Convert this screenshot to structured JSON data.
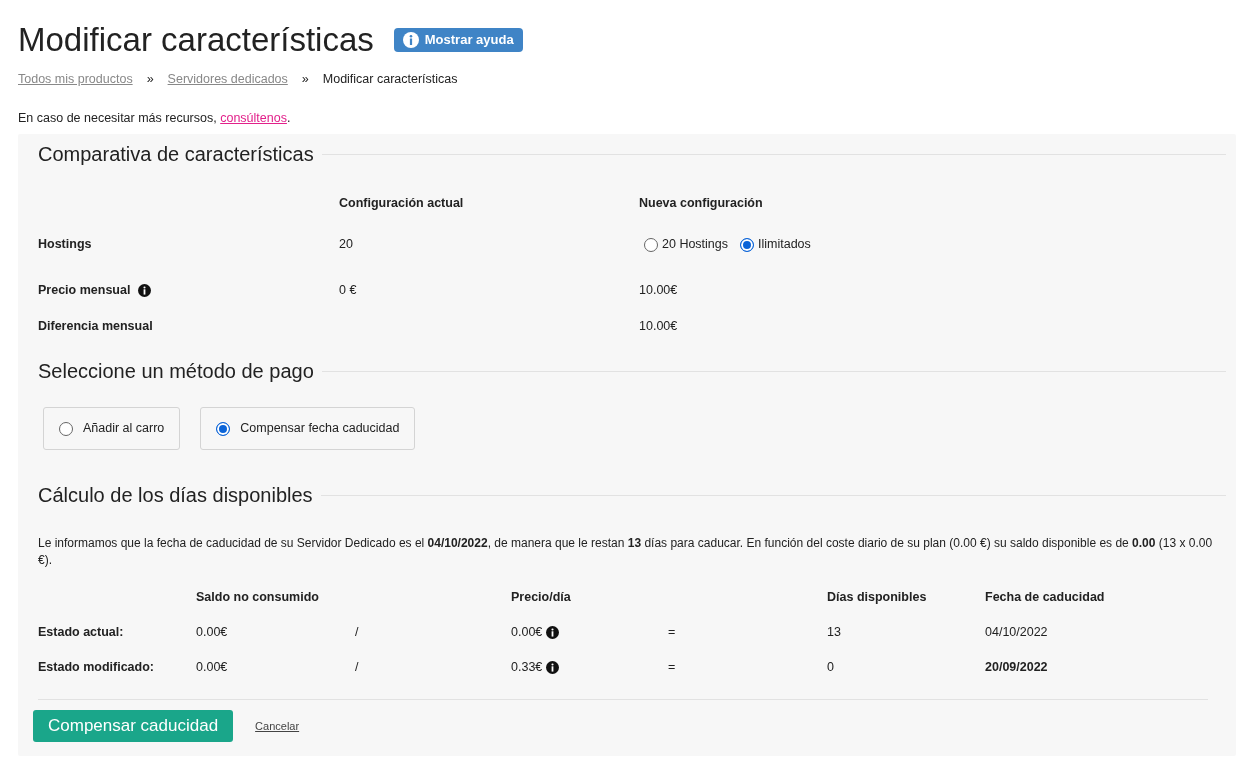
{
  "page": {
    "title": "Modificar características",
    "help_button": "Mostrar ayuda"
  },
  "breadcrumb": [
    {
      "label": "Todos mis productos",
      "link": true
    },
    {
      "label": "»",
      "link": false
    },
    {
      "label": "Servidores dedicados",
      "link": true
    },
    {
      "label": "»",
      "link": false
    },
    {
      "label": "Modificar características",
      "link": false
    }
  ],
  "intro": {
    "text": "En caso de necesitar más recursos,",
    "link": "consúltenos",
    "end": "."
  },
  "comparison": {
    "heading": "Comparativa de características",
    "columns": [
      "Configuración actual",
      "Nueva configuración"
    ],
    "rows": [
      {
        "kind": "options",
        "label": "Hostings",
        "info": false,
        "current": "20",
        "options": [
          {
            "label": "20 Hostings",
            "selected": false
          },
          {
            "label": "Ilimitados",
            "selected": true
          }
        ]
      },
      {
        "kind": "text",
        "label": "Precio mensual",
        "info": true,
        "current": "0 €",
        "new": "10.00€"
      },
      {
        "kind": "text",
        "label": "Diferencia mensual",
        "info": false,
        "new": "10.00€"
      }
    ]
  },
  "payment": {
    "heading": "Seleccione un método de pago",
    "options": [
      {
        "label": "Añadir al carro",
        "selected": false
      },
      {
        "label": "Compensar fecha caducidad",
        "selected": true
      }
    ]
  },
  "days": {
    "heading": "Cálculo de los días disponibles",
    "text": "Le informamos que la fecha de caducidad de su Servidor Dedicado es el **04/10/2022**, de manera que le restan **13** días para caducar. En función del coste diario de su plan (0.00 €) su saldo disponible es de **0.00** (13 x 0.00 €).",
    "columns": [
      "Saldo no consumido",
      "Precio/día",
      "Días disponibles",
      "Fecha de caducidad"
    ],
    "rows": [
      {
        "label": "Estado actual:",
        "saldo": "0.00€",
        "divide": "/",
        "precio": "0.00€",
        "equals": "=",
        "dias": "13",
        "fecha": "04/10/2022",
        "fecha_bold": false
      },
      {
        "label": "Estado modificado:",
        "saldo": "0.00€",
        "divide": "/",
        "precio": "0.33€",
        "equals": "=",
        "dias": "0",
        "fecha": "20/09/2022",
        "fecha_bold": true
      }
    ]
  },
  "actions": {
    "submit": "Compensar caducidad",
    "cancel": "Cancelar"
  }
}
